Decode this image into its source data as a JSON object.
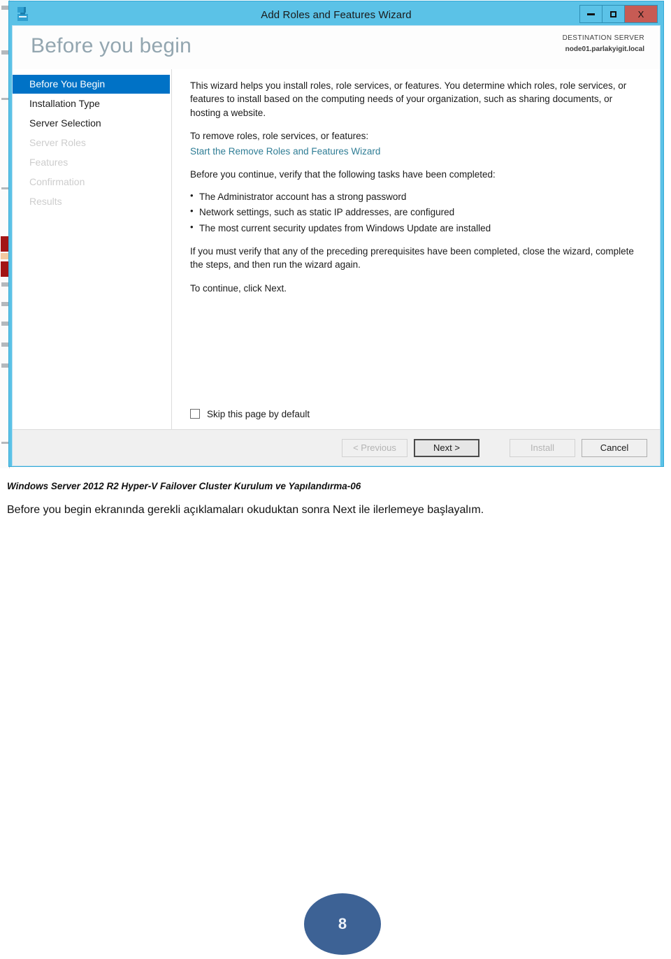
{
  "window": {
    "title": "Add Roles and Features Wizard",
    "app_icon": "server-manager-icon",
    "controls": {
      "minimize": "minimize-icon",
      "maximize": "maximize-icon",
      "close": "X"
    }
  },
  "header": {
    "page_title": "Before you begin",
    "destination_label": "DESTINATION SERVER",
    "destination_server": "node01.parlakyigit.local"
  },
  "sidebar": {
    "items": [
      {
        "label": "Before You Begin",
        "state": "selected"
      },
      {
        "label": "Installation Type",
        "state": "enabled"
      },
      {
        "label": "Server Selection",
        "state": "enabled"
      },
      {
        "label": "Server Roles",
        "state": "disabled"
      },
      {
        "label": "Features",
        "state": "disabled"
      },
      {
        "label": "Confirmation",
        "state": "disabled"
      },
      {
        "label": "Results",
        "state": "disabled"
      }
    ]
  },
  "content": {
    "intro": "This wizard helps you install roles, role services, or features. You determine which roles, role services, or features to install based on the computing needs of your organization, such as sharing documents, or hosting a website.",
    "remove_heading": "To remove roles, role services, or features:",
    "remove_link": "Start the Remove Roles and Features Wizard",
    "verify_heading": "Before you continue, verify that the following tasks have been completed:",
    "prerequisites": [
      "The Administrator account has a strong password",
      "Network settings, such as static IP addresses, are configured",
      "The most current security updates from Windows Update are installed"
    ],
    "verify_note": "If you must verify that any of the preceding prerequisites have been completed, close the wizard, complete the steps, and then run the wizard again.",
    "continue_note": "To continue, click Next.",
    "skip_checkbox_label": "Skip this page by default",
    "skip_checkbox_checked": false
  },
  "footer": {
    "buttons": [
      {
        "label": "< Previous",
        "state": "disabled"
      },
      {
        "label": "Next >",
        "state": "default"
      },
      {
        "label": "Install",
        "state": "disabled"
      },
      {
        "label": "Cancel",
        "state": "enabled"
      }
    ]
  },
  "document": {
    "caption_title": "Windows Server 2012 R2 Hyper-V Failover Cluster Kurulum ve Yapılandırma-06",
    "caption_body": "Before you begin ekranında gerekli açıklamaları okuduktan sonra Next ile ilerlemeye başlayalım.",
    "page_number": "8"
  },
  "colors": {
    "accent_blue": "#5bc2e7",
    "selected_blue": "#0072c6",
    "link_teal": "#2f7d95",
    "close_red": "#c75b54",
    "page_badge": "#3d6295"
  }
}
